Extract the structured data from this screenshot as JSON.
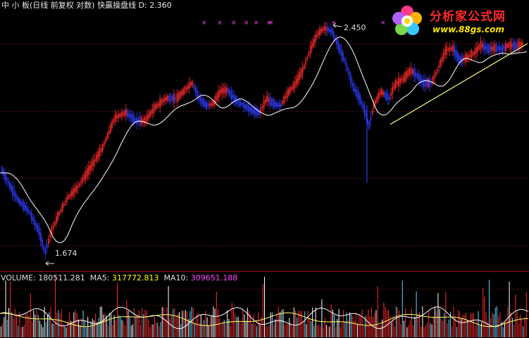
{
  "header": {
    "title": "中 小 板(日线 前复权 对数) 快赢操盘线",
    "d_label": "D:",
    "d_value": "2.360"
  },
  "price_markers": {
    "high": "2.450",
    "low": "1.674"
  },
  "volume_panel": {
    "volume_label": "VOLUME:",
    "volume_value": "180511.281",
    "ma5_label": "MA5:",
    "ma5_value": "317772.813",
    "ma10_label": "MA10:",
    "ma10_value": "309651.188"
  },
  "logo": {
    "title": "分析家公式网",
    "url": "www.88gs.com"
  },
  "colors": {
    "background": "#000000",
    "up_candle": "#ff2b2b",
    "down_candle": "#2f3dff",
    "ma_line": "#ffffff",
    "trend_line": "#ffff7a",
    "grid_dotted": "#8a1a1a",
    "header_text": "#e8e8e8",
    "d_value": "#ffff00",
    "ma5_value": "#ffff00",
    "ma10_value": "#ff44ff",
    "markers": "#ff44ff",
    "separator": "#a01010"
  }
}
